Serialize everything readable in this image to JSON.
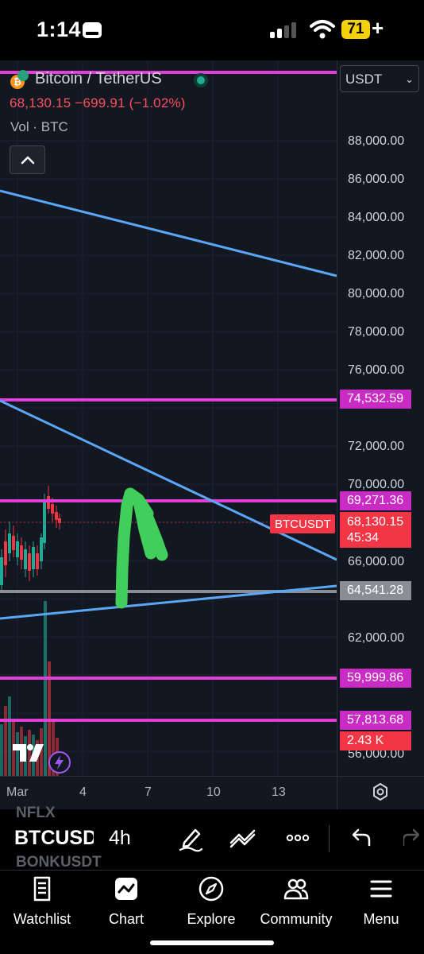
{
  "status_bar": {
    "time": "1:14",
    "battery": "71"
  },
  "chart_header": {
    "title": "Bitcoin / TetherUS",
    "price_line": "68,130.15  −699.91 (−1.02%)",
    "volume_label": "Vol · BTC",
    "currency": "USDT"
  },
  "price_axis": {
    "labels": [
      "88,000.00",
      "86,000.00",
      "84,000.00",
      "82,000.00",
      "80,000.00",
      "78,000.00",
      "76,000.00",
      "72,000.00",
      "70,000.00",
      "66,000.00",
      "62,000.00",
      "56,000.00"
    ],
    "pink_tags": [
      "74,532.59",
      "69,271.36",
      "59,999.86",
      "57,813.68"
    ],
    "gray_tag": "64,541.28",
    "last_price": "68,130.15",
    "countdown": "45:34",
    "symbol_flag": "BTCUSDT",
    "volume_tag": "2.43 K"
  },
  "time_axis": {
    "labels": [
      "Mar",
      "4",
      "7",
      "10",
      "13"
    ]
  },
  "toolbar": {
    "ghost_above": "NFLX",
    "symbol": "BTCUSDT",
    "ghost_below": "BONKUSDT",
    "interval": "4h"
  },
  "bottom_nav": {
    "items": [
      {
        "label": "Watchlist",
        "icon": "watchlist-icon"
      },
      {
        "label": "Chart",
        "icon": "chart-icon"
      },
      {
        "label": "Explore",
        "icon": "compass-icon"
      },
      {
        "label": "Community",
        "icon": "community-icon"
      },
      {
        "label": "Menu",
        "icon": "menu-icon"
      }
    ]
  },
  "colors": {
    "background": "#131722",
    "horizontal_level": "#e040d8",
    "trendline": "#5aa7f5",
    "down_candle": "#f23645",
    "up_candle": "#22ab94",
    "arrow": "#3fcf5a"
  }
}
